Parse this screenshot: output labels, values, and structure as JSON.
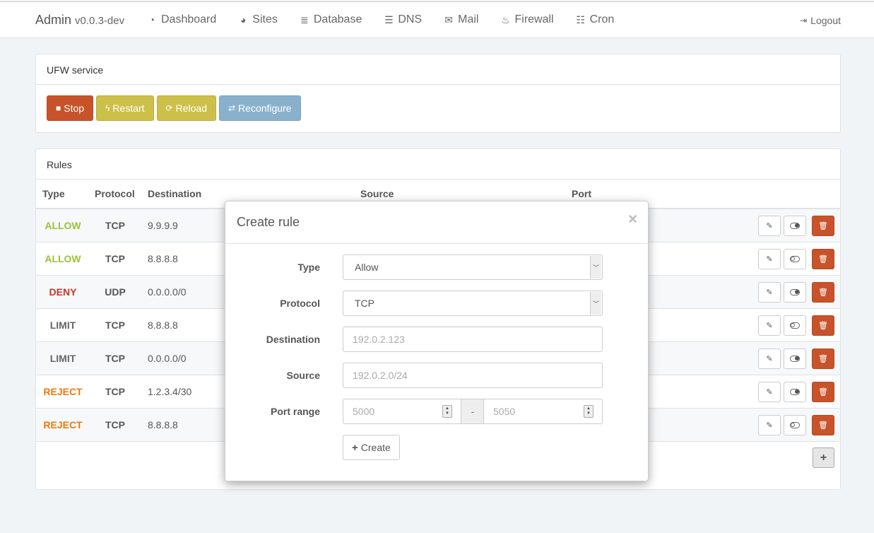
{
  "navbar": {
    "brand": "Admin",
    "version": "v0.0.3-dev",
    "items": [
      {
        "label": "Dashboard",
        "icon": "dashboard-icon",
        "glyph": "◔"
      },
      {
        "label": "Sites",
        "icon": "globe-icon",
        "glyph": "◕"
      },
      {
        "label": "Database",
        "icon": "database-icon",
        "glyph": "≣"
      },
      {
        "label": "DNS",
        "icon": "server-icon",
        "glyph": "☰"
      },
      {
        "label": "Mail",
        "icon": "envelope-icon",
        "glyph": "✉"
      },
      {
        "label": "Firewall",
        "icon": "fire-icon",
        "glyph": "♨"
      },
      {
        "label": "Cron",
        "icon": "list-icon",
        "glyph": "☷"
      }
    ],
    "logout": "Logout"
  },
  "service_panel": {
    "title": "UFW service",
    "buttons": {
      "stop": "Stop",
      "restart": "Restart",
      "reload": "Reload",
      "reconfigure": "Reconfigure"
    }
  },
  "rules_panel": {
    "title": "Rules",
    "columns": {
      "type": "Type",
      "protocol": "Protocol",
      "destination": "Destination",
      "source": "Source",
      "port": "Port"
    },
    "rows": [
      {
        "type": "ALLOW",
        "protocol": "TCP",
        "destination": "9.9.9.9",
        "enabled": true
      },
      {
        "type": "ALLOW",
        "protocol": "TCP",
        "destination": "8.8.8.8",
        "enabled": false
      },
      {
        "type": "DENY",
        "protocol": "UDP",
        "destination": "0.0.0.0/0",
        "enabled": true
      },
      {
        "type": "LIMIT",
        "protocol": "TCP",
        "destination": "8.8.8.8",
        "enabled": false
      },
      {
        "type": "LIMIT",
        "protocol": "TCP",
        "destination": "0.0.0.0/0",
        "enabled": true
      },
      {
        "type": "REJECT",
        "protocol": "TCP",
        "destination": "1.2.3.4/30",
        "enabled": true
      },
      {
        "type": "REJECT",
        "protocol": "TCP",
        "destination": "8.8.8.8",
        "enabled": false
      }
    ],
    "add_label": "+"
  },
  "modal": {
    "title": "Create rule",
    "close": "×",
    "fields": {
      "type_label": "Type",
      "type_value": "Allow",
      "protocol_label": "Protocol",
      "protocol_value": "TCP",
      "destination_label": "Destination",
      "destination_placeholder": "192.0.2.123",
      "source_label": "Source",
      "source_placeholder": "192.0.2.0/24",
      "port_label": "Port range",
      "port_from_placeholder": "5000",
      "port_separator": "-",
      "port_to_placeholder": "5050"
    },
    "create_label": "Create"
  },
  "colors": {
    "allow": "#9bc03a",
    "deny": "#c0392b",
    "limit": "#666666",
    "reject": "#f0780a",
    "danger": "#c8532a",
    "warning": "#cdc04a",
    "info": "#8ab1cc"
  }
}
